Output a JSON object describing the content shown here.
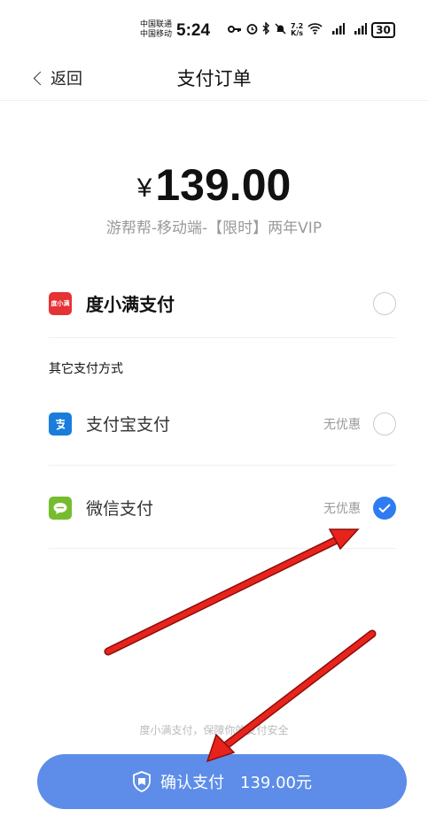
{
  "status_bar": {
    "carrier_1": "中国联通",
    "carrier_2": "中国移动",
    "time": "5:24",
    "net_speed_value": "7.2",
    "net_speed_unit": "K/s",
    "battery": "30"
  },
  "nav": {
    "back_label": "返回",
    "title": "支付订单"
  },
  "order": {
    "currency": "¥",
    "amount": "139.00",
    "product": "游帮帮-移动端-【限时】两年VIP"
  },
  "payment": {
    "primary": {
      "label": "度小满支付",
      "icon_text": "度小满",
      "selected": false
    },
    "others_title": "其它支付方式",
    "methods": [
      {
        "label": "支付宝支付",
        "discount": "无优惠",
        "icon": "alipay-icon",
        "selected": false
      },
      {
        "label": "微信支付",
        "discount": "无优惠",
        "icon": "wechat-icon",
        "selected": true
      }
    ]
  },
  "footer": {
    "security_note": "度小满支付，保障你的支付安全",
    "confirm_label": "确认支付",
    "confirm_amount": "139.00元"
  },
  "colors": {
    "accent": "#2f7bf3",
    "button": "#5d8de8",
    "annotation_arrow": "#e8231c"
  }
}
